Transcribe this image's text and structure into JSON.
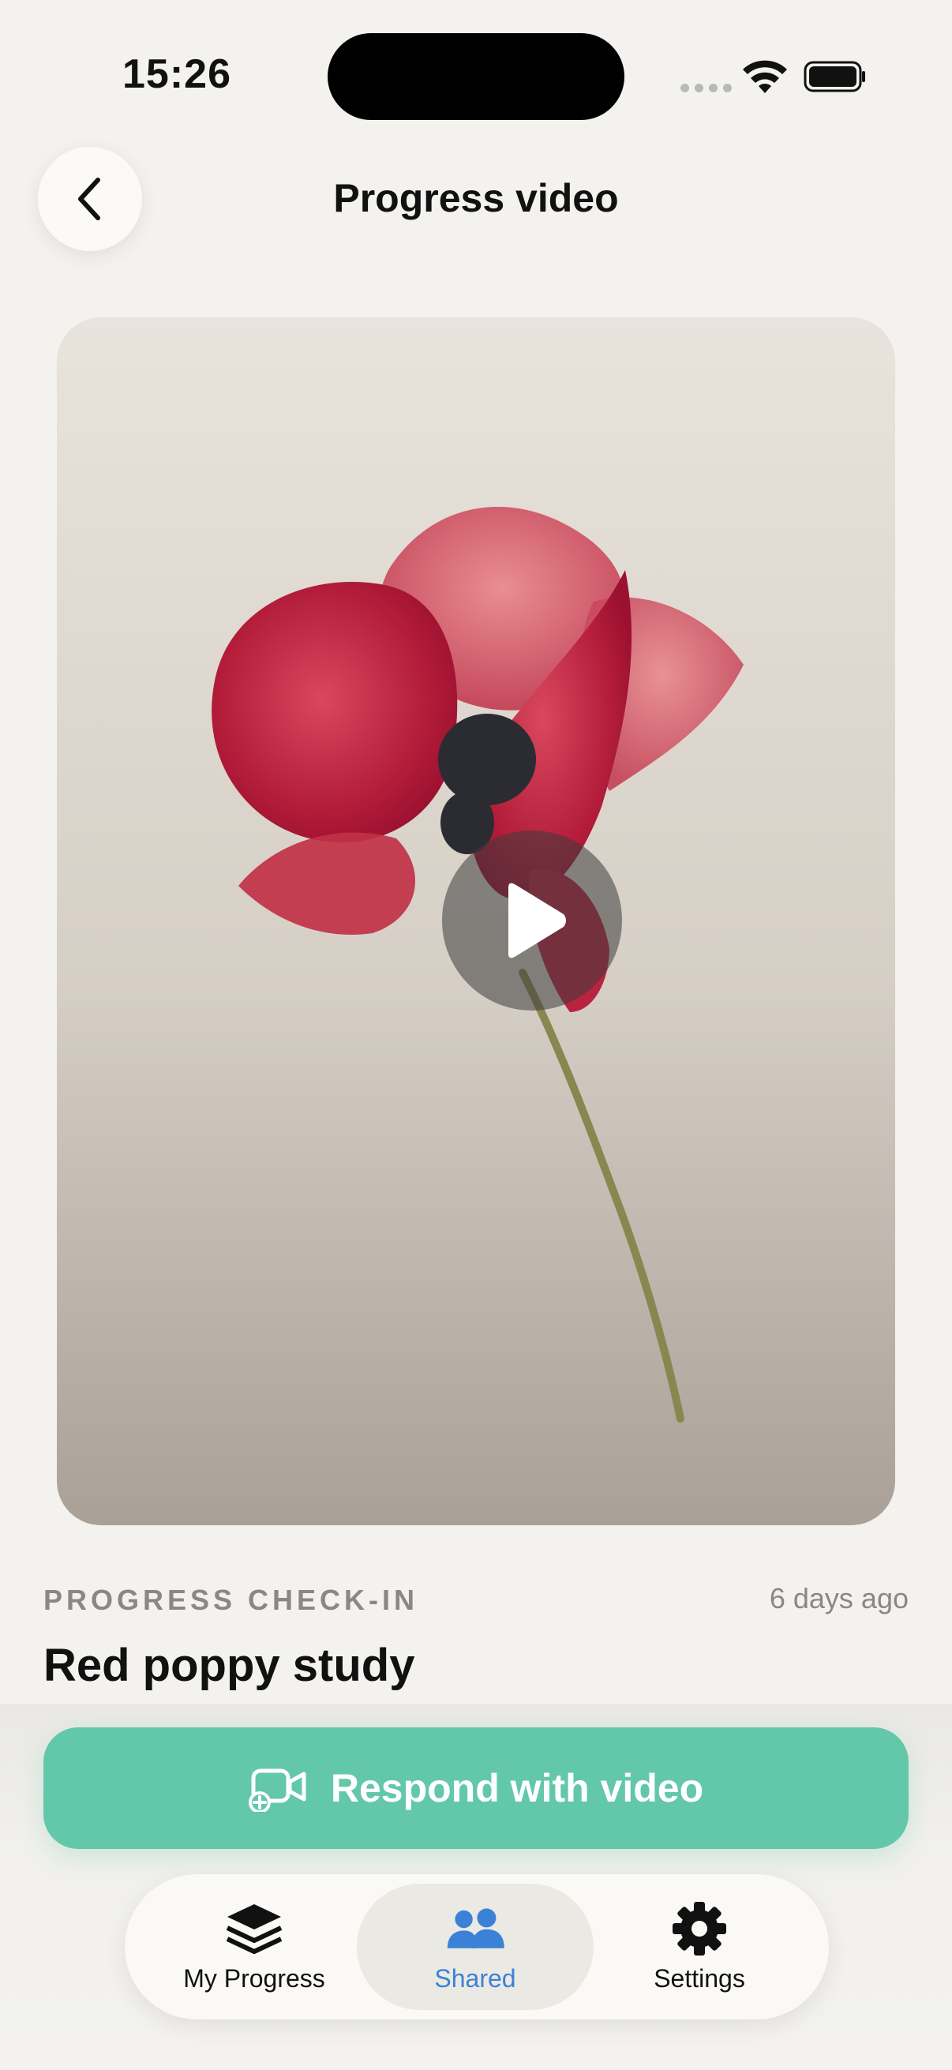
{
  "status_bar": {
    "time": "15:26"
  },
  "header": {
    "title": "Progress video"
  },
  "video": {
    "play_icon": "play-icon",
    "subject": "red poppy watercolor"
  },
  "meta": {
    "kicker": "PROGRESS CHECK-IN",
    "timestamp": "6 days ago",
    "title": "Red poppy study"
  },
  "actions": {
    "respond_label": "Respond with video"
  },
  "tabbar": {
    "items": [
      {
        "label": "My Progress",
        "icon": "stack-icon",
        "active": false
      },
      {
        "label": "Shared",
        "icon": "people-icon",
        "active": true
      },
      {
        "label": "Settings",
        "icon": "gear-icon",
        "active": false
      }
    ]
  },
  "colors": {
    "accent": "#62c8a9",
    "tab_active": "#3b82d6",
    "background": "#f4f2ee"
  }
}
